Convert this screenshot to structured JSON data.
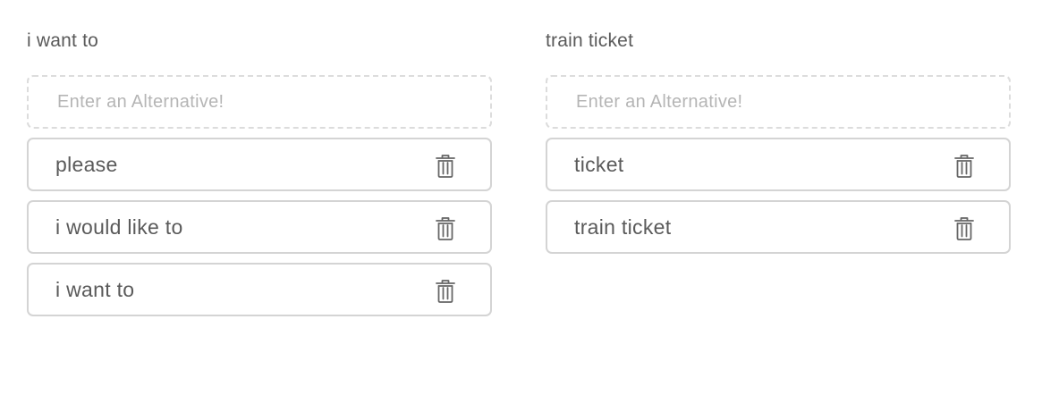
{
  "groups": [
    {
      "title": "i want to",
      "input": {
        "placeholder": "Enter an Alternative!",
        "value": ""
      },
      "alternatives": [
        {
          "label": "please",
          "icon": "trash-icon"
        },
        {
          "label": "i would like to",
          "icon": "trash-icon"
        },
        {
          "label": "i want to",
          "icon": "trash-icon"
        }
      ]
    },
    {
      "title": "train ticket",
      "input": {
        "placeholder": "Enter an Alternative!",
        "value": ""
      },
      "alternatives": [
        {
          "label": "ticket",
          "icon": "trash-icon"
        },
        {
          "label": "train ticket",
          "icon": "trash-icon"
        }
      ]
    }
  ],
  "colors": {
    "text": "#5a5a5a",
    "placeholder": "#b5b5b5",
    "border": "#d4d4d4",
    "dashed_border": "#dcdcdc"
  }
}
